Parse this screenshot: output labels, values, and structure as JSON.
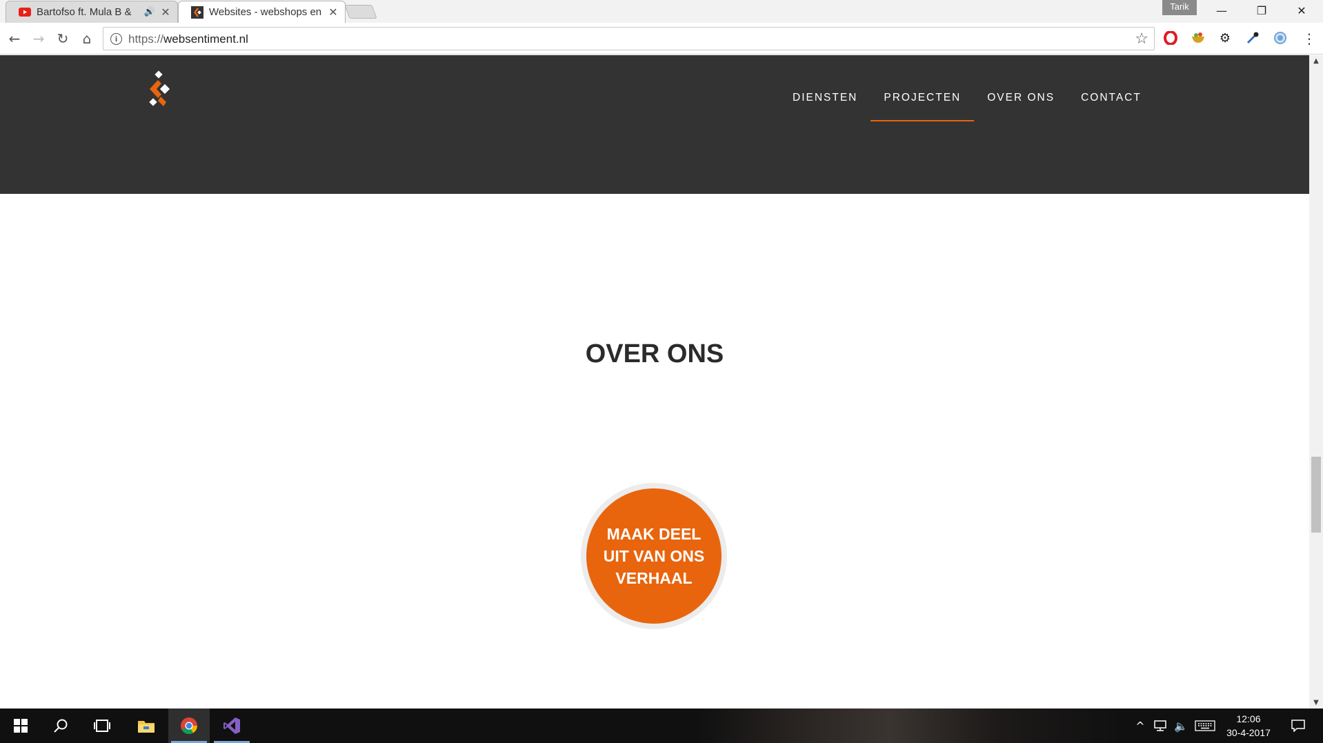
{
  "browser": {
    "tabs": [
      {
        "title": "Bartofso ft. Mula B &",
        "favicon": "youtube-icon",
        "audio": true,
        "active": false
      },
      {
        "title": "Websites - webshops en",
        "favicon": "websentiment-icon",
        "active": true
      }
    ],
    "profile_name": "Tarik",
    "window_controls": {
      "minimize": "—",
      "restore": "❐",
      "close": "✕"
    },
    "address_bar": {
      "scheme": "https://",
      "host": "websentiment.nl"
    },
    "nav_icons": {
      "back": "←",
      "forward": "→",
      "reload": "↻",
      "home": "⌂",
      "star": "☆",
      "menu": "⋮"
    },
    "extensions": [
      "opera-icon",
      "extension-bowl-icon",
      "gear-icon",
      "eyedropper-icon",
      "circle-extension-icon"
    ]
  },
  "site": {
    "nav": [
      {
        "label": "DIENSTEN",
        "active": false
      },
      {
        "label": "PROJECTEN",
        "active": true
      },
      {
        "label": "OVER ONS",
        "active": false
      },
      {
        "label": "CONTACT",
        "active": false
      }
    ],
    "section_title": "OVER ONS",
    "cta_label": "MAAK DEEL UIT VAN ONS VERHAAL"
  },
  "colors": {
    "header_bg": "#333333",
    "accent": "#e8650e",
    "title_text": "#2b2b2b"
  },
  "taskbar": {
    "apps": [
      "windows-start-icon",
      "search-icon",
      "task-view-icon",
      "file-explorer-icon",
      "chrome-icon",
      "visual-studio-icon"
    ],
    "clock_time": "12:06",
    "clock_date": "30-4-2017"
  }
}
